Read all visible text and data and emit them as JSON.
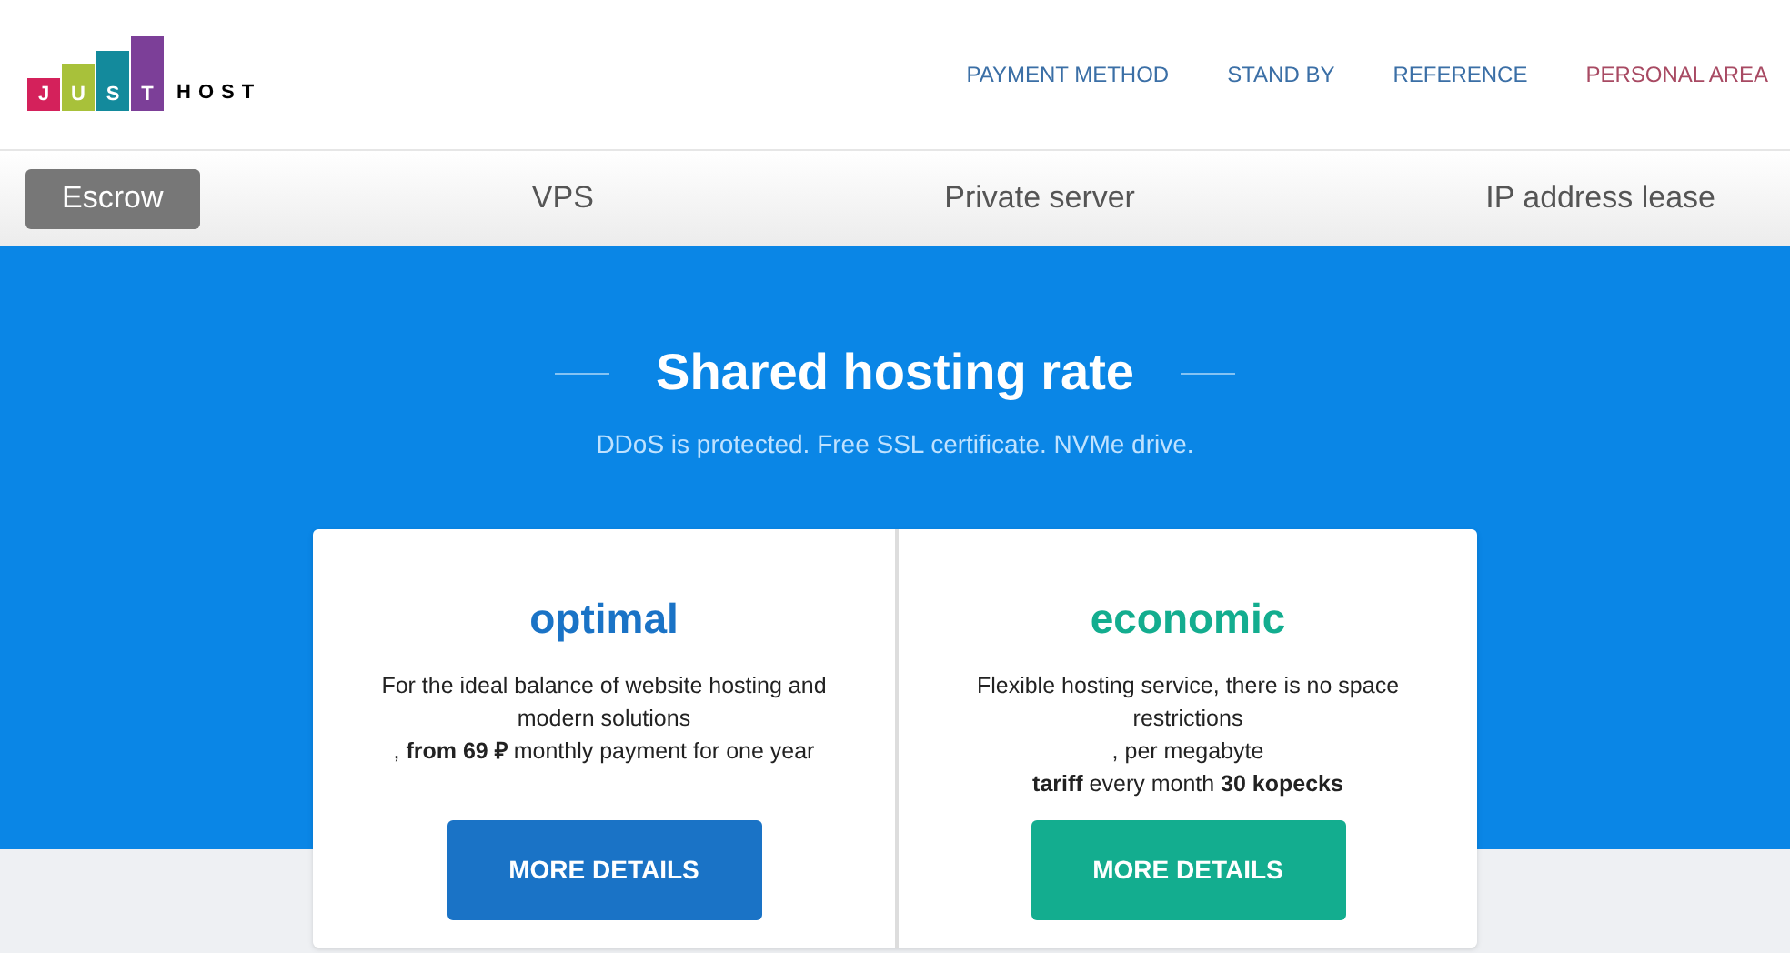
{
  "logo": {
    "letters": [
      "J",
      "U",
      "S",
      "T"
    ],
    "word": "HOST"
  },
  "menu": [
    {
      "label": "PAYMENT METHOD",
      "accent": false
    },
    {
      "label": "STAND BY",
      "accent": false
    },
    {
      "label": "REFERENCE",
      "accent": false
    },
    {
      "label": "PERSONAL AREA",
      "accent": true
    }
  ],
  "tabs": [
    {
      "label": "Escrow",
      "selected": true
    },
    {
      "label": "VPS",
      "selected": false
    },
    {
      "label": "Private server",
      "selected": false
    },
    {
      "label": "IP address lease",
      "selected": false
    }
  ],
  "hero": {
    "title": "Shared hosting rate",
    "subtitle": "DDoS is protected. Free SSL certificate. NVMe drive."
  },
  "plans": [
    {
      "name": "optimal",
      "color": "#1a73c6",
      "lines": [
        "For the ideal balance of website hosting and modern solutions",
        ", **from 69 ₽** monthly payment for one year"
      ],
      "button": "MORE DETAILS"
    },
    {
      "name": "economic",
      "color": "#13ad8f",
      "lines": [
        "Flexible hosting service, there is no space restrictions",
        ", per megabyte",
        "**tariff** every month **30 kopecks**"
      ],
      "button": "MORE DETAILS"
    }
  ]
}
